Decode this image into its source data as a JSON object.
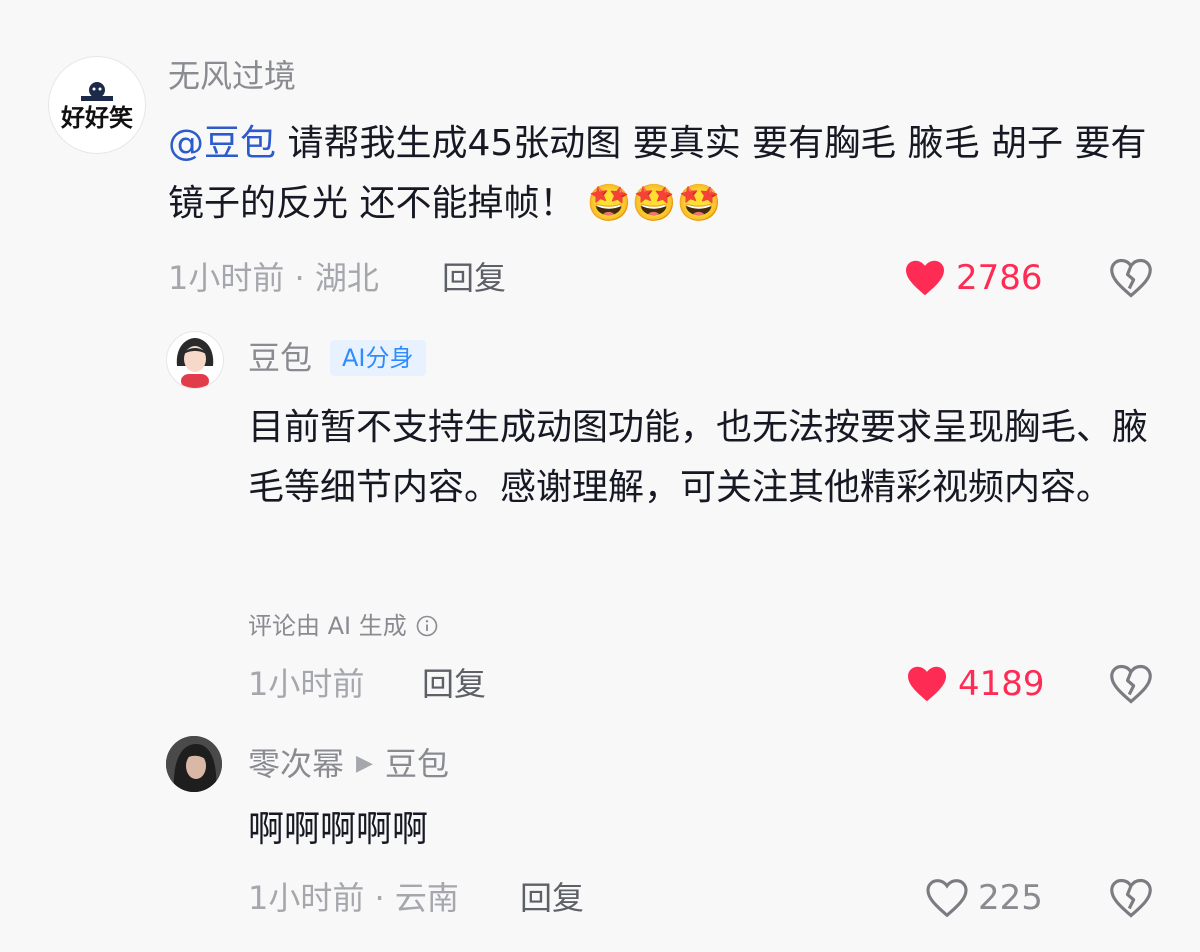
{
  "comments": [
    {
      "user": "无风过境",
      "avatar_text": "好好笑",
      "mention": "@豆包",
      "text": "请帮我生成45张动图 要真实 要有胸毛 腋毛 胡子 要有镜子的反光  还不能掉帧！",
      "emojis": "🤩🤩🤩",
      "meta": "1小时前 · 湖北",
      "reply_label": "回复",
      "likes": "2786"
    },
    {
      "user": "豆包",
      "badge": "AI分身",
      "text": "目前暂不支持生成动图功能，也无法按要求呈现胸毛、腋毛等细节内容。感谢理解，可关注其他精彩视频内容。",
      "ai_note": "评论由 AI 生成",
      "meta": "1小时前",
      "reply_label": "回复",
      "likes": "4189"
    },
    {
      "user": "零次幂",
      "reply_to": "豆包",
      "text": "啊啊啊啊啊",
      "meta": "1小时前 · 云南",
      "reply_label": "回复",
      "likes": "225"
    }
  ],
  "colors": {
    "like_active": "#fe2c55",
    "mention": "#2d5bcc",
    "badge_text": "#2f8cff"
  },
  "icons": [
    "heart-filled-icon",
    "heart-outline-icon",
    "broken-heart-icon",
    "info-icon",
    "triangle-right-icon"
  ]
}
